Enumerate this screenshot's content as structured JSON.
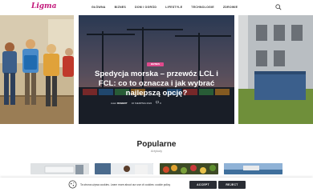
{
  "header": {
    "logo": "Ligma",
    "nav": [
      "GŁÓWNA",
      "BIZNES",
      "DOM I OGRÓD",
      "LIFESTYLE",
      "TECHNOLOGIE",
      "ZDROWIE"
    ],
    "search_icon": "search-icon"
  },
  "slider": {
    "center": {
      "badge": "BIZNES",
      "title": "Spedycja morska – przewóz LCL i FCL: co to oznacza i jak wybrać najlepszą opcję?",
      "author_prefix": "Autor",
      "author": "ROBERT",
      "date": "16 SIERPNIA 2022",
      "comments": "0"
    }
  },
  "section": {
    "title": "Popularne",
    "subtitle": "Artykuły"
  },
  "cookie": {
    "text": "Ta strona używa cookies. Learn more about our use of cookies: cookie policy",
    "accept": "ACCEPT",
    "reject": "REJECT",
    "icon": "cookie-icon"
  },
  "colors": {
    "accent": "#c2187a",
    "badge": "#e04a8c",
    "button": "#2a2d34"
  }
}
